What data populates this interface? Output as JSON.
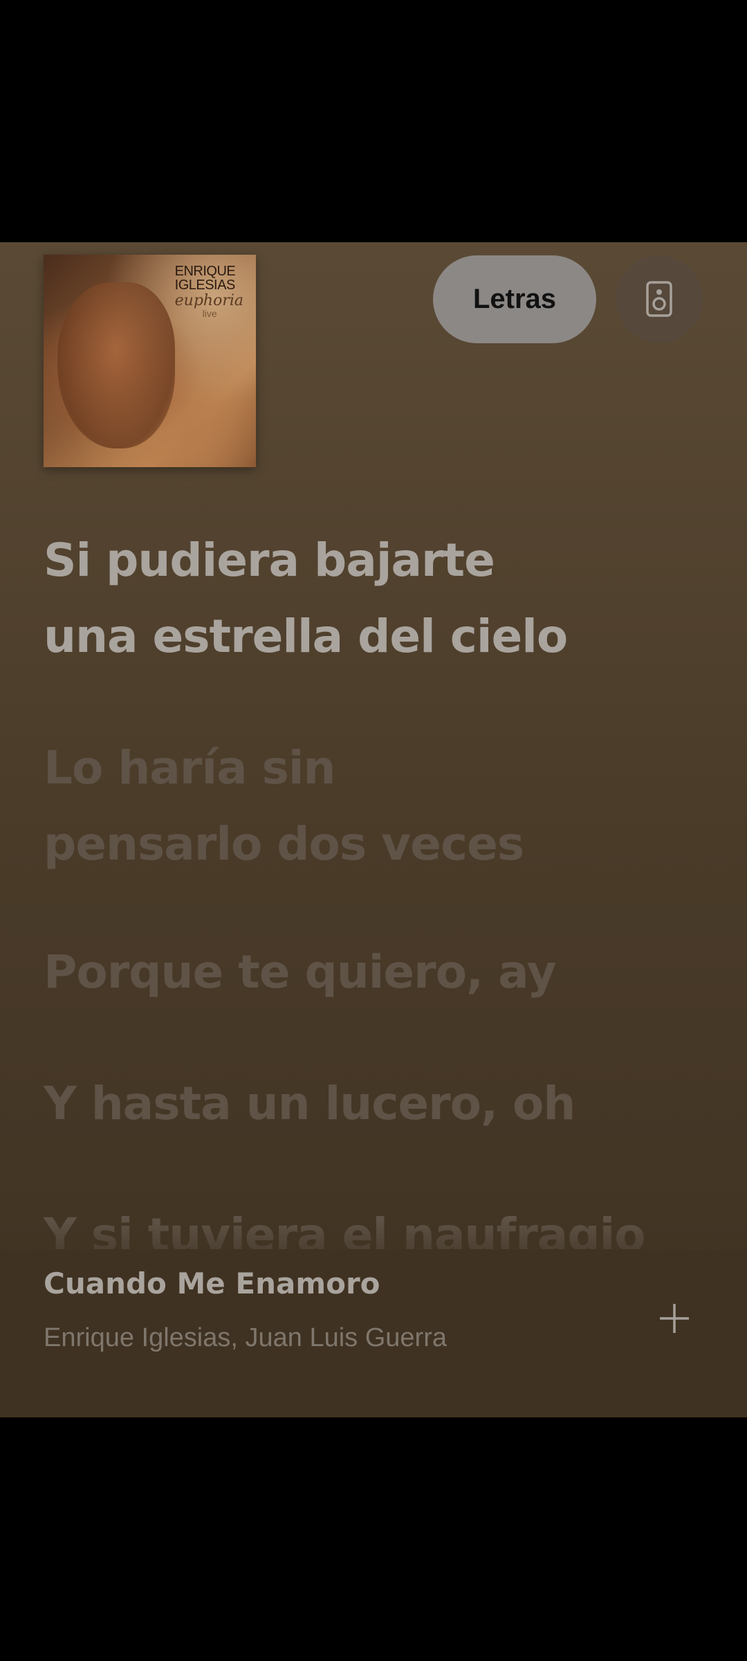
{
  "album": {
    "artist_text_line1": "ENRIQUE",
    "artist_text_line2": "IGLESIAS",
    "title_text": "euphoria",
    "sub_text": "live"
  },
  "controls": {
    "lyrics_button": "Letras",
    "speaker_icon": "speaker-icon"
  },
  "lyrics": [
    "Si pudiera bajarte\nuna estrella del cielo",
    "Lo haría sin\npensarlo dos veces",
    "Porque te quiero, ay",
    "Y hasta un lucero, oh",
    "Y si tuviera el naufragio"
  ],
  "track": {
    "title": "Cuando Me Enamoro",
    "artists": "Enrique Iglesias, Juan Luis Guerra",
    "add_icon": "plus-icon"
  },
  "colors": {
    "background": "#4a3b29",
    "active_lyric": "#aaa49e",
    "inactive_lyric": "#5f5347",
    "button_bg": "#8c8885"
  }
}
